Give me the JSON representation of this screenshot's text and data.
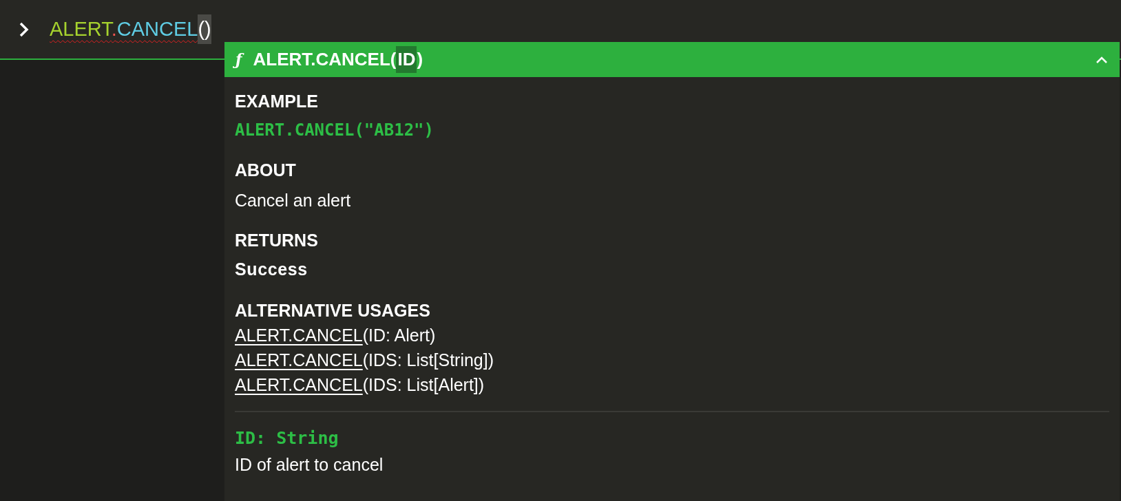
{
  "prompt": {
    "error": true,
    "tokens": [
      {
        "text": "ALERT",
        "kind": "namespace"
      },
      {
        "text": ".",
        "kind": "dot"
      },
      {
        "text": "CANCEL",
        "kind": "function"
      },
      {
        "text": "()",
        "kind": "paren"
      }
    ]
  },
  "popup": {
    "expanded": true,
    "signature": {
      "icon": "ƒ",
      "name": "ALERT.CANCEL",
      "open": "(",
      "param": "ID",
      "close": ")"
    },
    "example": {
      "heading": "EXAMPLE",
      "code": "ALERT.CANCEL(\"AB12\")"
    },
    "about": {
      "heading": "ABOUT",
      "text": "Cancel an alert"
    },
    "returns": {
      "heading": "RETURNS",
      "text": "Success"
    },
    "alternatives": {
      "heading": "ALTERNATIVE USAGES",
      "items": [
        {
          "link": "ALERT.CANCEL",
          "rest": "(ID: Alert)"
        },
        {
          "link": "ALERT.CANCEL",
          "rest": "(IDS: List[String])"
        },
        {
          "link": "ALERT.CANCEL",
          "rest": "(IDS: List[Alert])"
        }
      ]
    },
    "params": [
      {
        "signature": "ID: String",
        "description": "ID of alert to cancel"
      }
    ]
  }
}
